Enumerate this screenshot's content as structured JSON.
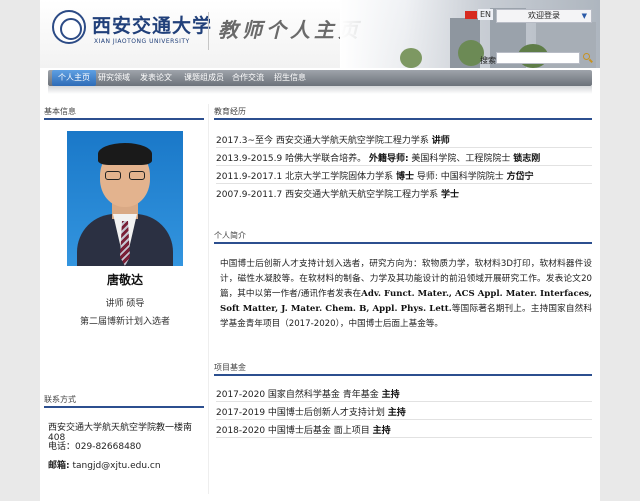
{
  "header": {
    "logo_cn": "西安交通大学",
    "logo_en": "XIAN JIAOTONG UNIVERSITY",
    "site_title": "教师个人主页",
    "lang": "EN",
    "login_label": "欢迎登录",
    "search_label": "搜索.",
    "search_value": ""
  },
  "nav": {
    "items": [
      "个人主页",
      "研究领域",
      "发表论文",
      "课题组成员",
      "合作交流",
      "招生信息"
    ]
  },
  "sidebar": {
    "basic_title": "基本信息",
    "name": "唐敬达",
    "position": "讲师 硕导",
    "honor": "第二届博新计划入选者",
    "contact_title": "联系方式",
    "address": "西安交通大学航天航空学院教一楼南408",
    "phone_label": "电话：",
    "phone": "029-82668480",
    "email_label": "邮箱:",
    "email": "tangjd@xjtu.edu.cn"
  },
  "education": {
    "title": "教育经历",
    "rows": [
      {
        "text": "2017.3~至今  西安交通大学航天航空学院工程力学系 ",
        "bold": "讲师"
      },
      {
        "text": "2013.9-2015.9 哈佛大学联合培养。 ",
        "bold": "外籍导师:",
        "text2": " 美国科学院、工程院院士 ",
        "bold2": "锁志刚"
      },
      {
        "text": "2011.9-2017.1 北京大学工学院固体力学系 ",
        "bold": "博士",
        "text2": "  导师:  中国科学院院士 ",
        "bold2": "方岱宁"
      },
      {
        "text": "2007.9-2011.7 西安交通大学航天航空学院工程力学系 ",
        "bold": "学士"
      }
    ]
  },
  "bio": {
    "title": "个人简介",
    "p1": "中国博士后创新人才支持计划入选者，研究方向为：软物质力学，软材料3D打印，软材料器件设计，磁性水凝胶等。在软材料的制备、力学及其功能设计的前沿领域开展研究工作。发表论文20篇，其中以第一作者/通讯作者发表在",
    "journals": "Adv. Funct. Mater., ACS Appl. Mater. Interfaces, Soft Matter, J. Mater. Chem. B, Appl. Phys. Lett.",
    "p2": "等国际著名期刊上。主持国家自然科学基金青年项目（2017-2020），中国博士后面上基金等。"
  },
  "projects": {
    "title": "项目基金",
    "rows": [
      {
        "text": "2017-2020 国家自然科学基金 青年基金 ",
        "bold": "主持"
      },
      {
        "text": "2017-2019 中国博士后创新人才支持计划 ",
        "bold": "主持"
      },
      {
        "text": "2018-2020 中国博士后基金 面上项目 ",
        "bold": "主持"
      }
    ]
  },
  "colors": {
    "accent": "#2c4f8f",
    "nav_active": "#2d6bb7",
    "flag": "#d72b20"
  }
}
